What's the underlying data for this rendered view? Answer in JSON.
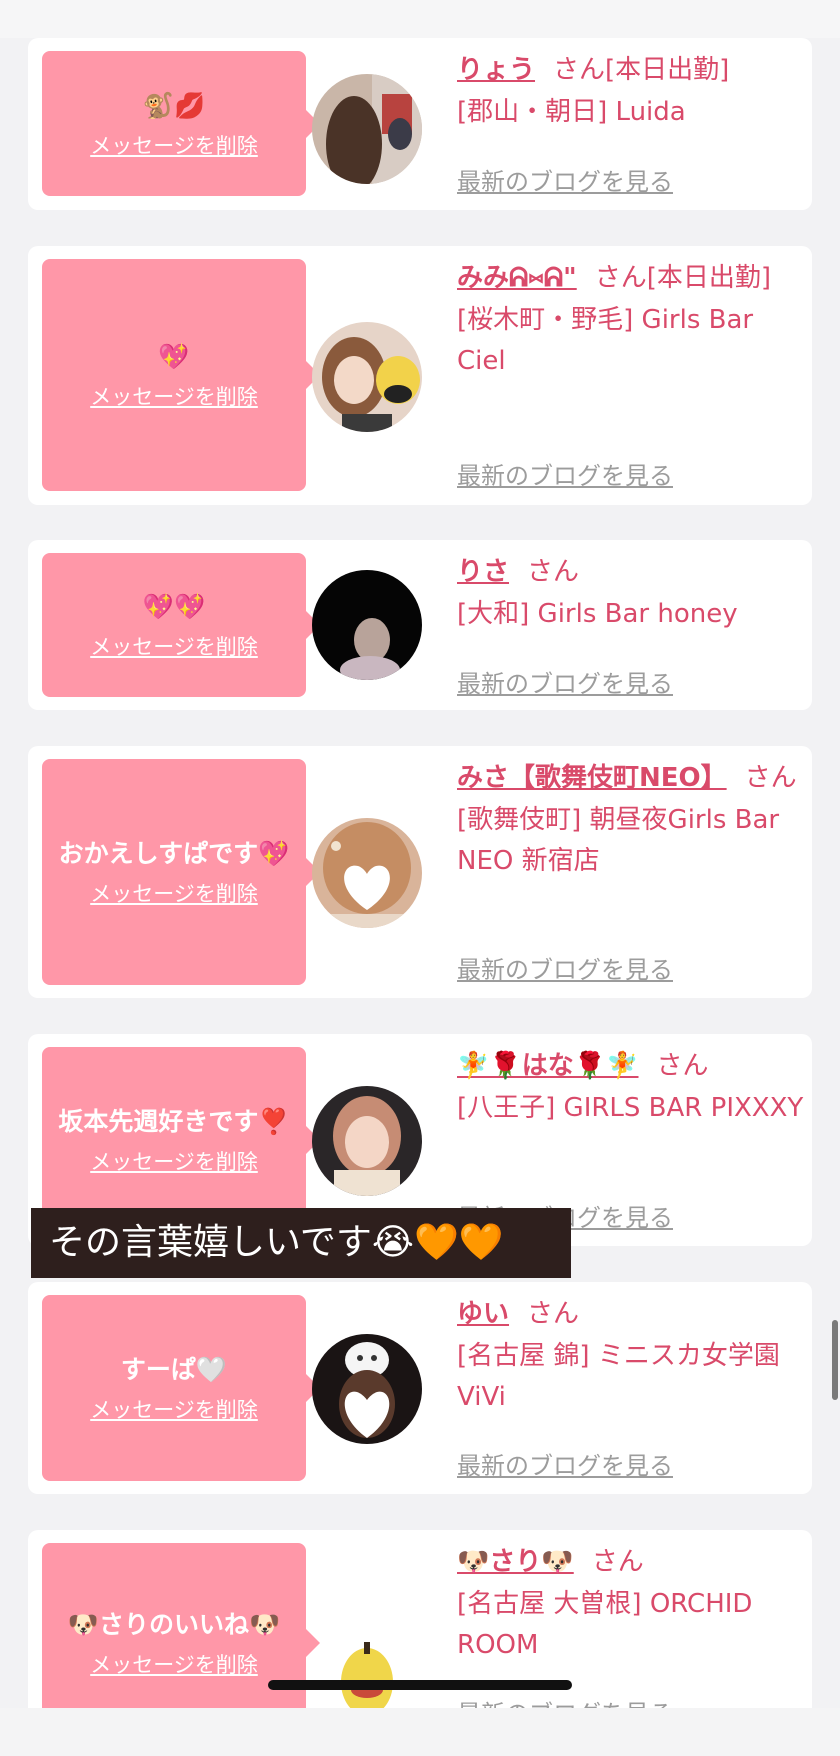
{
  "honorific": "さん",
  "delete_label": "メッセージを削除",
  "blog_label": "最新のブログを見る",
  "caption": "その言葉嬉しいです😭🧡🧡",
  "colors": {
    "bubble": "#ff97a8",
    "name": "#d94a6a",
    "link_gray": "#9c9c9c",
    "card": "#ffffff",
    "background": "#f2f2f4"
  },
  "cards": [
    {
      "message": "🐒💋",
      "name": "りょう",
      "status": "[本日出勤]",
      "shop": "[郡山・朝日] Luida"
    },
    {
      "message": "💖",
      "name": "みみᕱ⑅ᕱ\"",
      "status": "[本日出勤]",
      "shop": "[桜木町・野毛] Girls Bar Ciel"
    },
    {
      "message": "💖💖",
      "name": "りさ",
      "status": "",
      "shop": "[大和] Girls Bar honey"
    },
    {
      "message": "おかえしすぱです💖",
      "name": "みさ【歌舞伎町NEO】",
      "status": "",
      "shop": "[歌舞伎町] 朝昼夜Girls Bar NEO 新宿店"
    },
    {
      "message": "坂本先週好きです❣️",
      "name": "🧚🌹はな🌹🧚",
      "status": "",
      "shop": "[八王子] GIRLS BAR PIXXXY"
    },
    {
      "message": "すーぱ🤍",
      "name": "ゆい",
      "status": "",
      "shop": "[名古屋 錦] ミニスカ女学園ViVi"
    },
    {
      "message": "🐶さりのいいね🐶",
      "name": "🐶さり🐶",
      "status": "",
      "shop": "[名古屋 大曽根] ORCHID ROOM"
    }
  ]
}
